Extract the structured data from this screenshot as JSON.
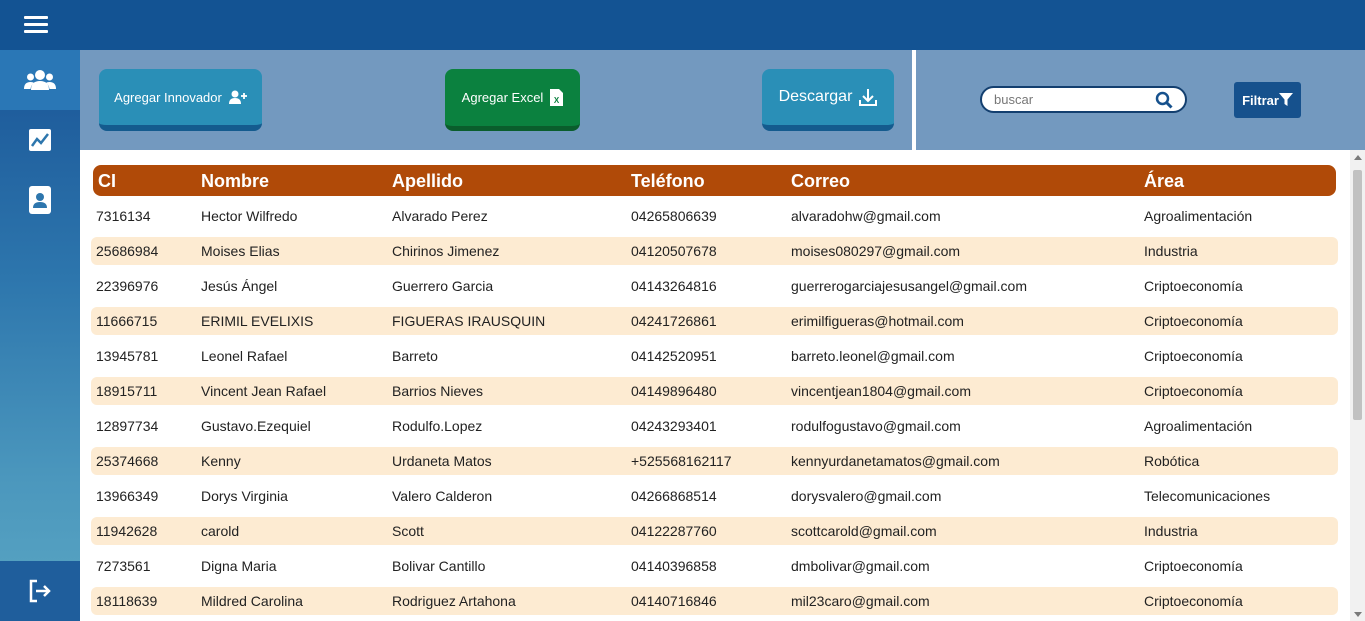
{
  "toolbar": {
    "agregar_label": "Agregar Innovador",
    "excel_label": "Agregar Excel",
    "descargar_label": "Descargar",
    "search_placeholder": "buscar",
    "filtrar_label": "Filtrar"
  },
  "sidebar": {
    "items": [
      {
        "icon": "users-icon",
        "active": true
      },
      {
        "icon": "chart-icon",
        "active": false
      },
      {
        "icon": "contact-icon",
        "active": false
      }
    ],
    "logout_icon": "logout-icon"
  },
  "table": {
    "headers": [
      "CI",
      "Nombre",
      "Apellido",
      "Teléfono",
      "Correo",
      "Área"
    ],
    "rows": [
      [
        "7316134",
        "Hector Wilfredo",
        "Alvarado Perez",
        "04265806639",
        "alvaradohw@gmail.com",
        "Agroalimentación"
      ],
      [
        "25686984",
        "Moises Elias",
        "Chirinos Jimenez",
        "04120507678",
        "moises080297@gmail.com",
        "Industria"
      ],
      [
        "22396976",
        "Jesús Ángel",
        "Guerrero Garcia",
        "04143264816",
        "guerrerogarciajesusangel@gmail.com",
        "Criptoeconomía"
      ],
      [
        "11666715",
        "ERIMIL EVELIXIS",
        "FIGUERAS IRAUSQUIN",
        "04241726861",
        "erimilfigueras@hotmail.com",
        "Criptoeconomía"
      ],
      [
        "13945781",
        "Leonel Rafael",
        "Barreto",
        "04142520951",
        "barreto.leonel@gmail.com",
        "Criptoeconomía"
      ],
      [
        "18915711",
        "Vincent Jean Rafael",
        "Barrios Nieves",
        "04149896480",
        "vincentjean1804@gmail.com",
        "Criptoeconomía"
      ],
      [
        "12897734",
        "Gustavo.Ezequiel",
        "Rodulfo.Lopez",
        "04243293401",
        "rodulfogustavo@gmail.com",
        "Agroalimentación"
      ],
      [
        "25374668",
        "Kenny",
        "Urdaneta Matos",
        "+525568162117",
        "kennyurdanetamatos@gmail.com",
        "Robótica"
      ],
      [
        "13966349",
        "Dorys Virginia",
        "Valero Calderon",
        "04266868514",
        "dorysvalero@gmail.com",
        "Telecomunicaciones"
      ],
      [
        "11942628",
        "carold",
        "Scott",
        "04122287760",
        "scottcarold@gmail.com",
        "Industria"
      ],
      [
        "7273561",
        "Digna Maria",
        "Bolivar Cantillo",
        "04140396858",
        "dmbolivar@gmail.com",
        "Criptoeconomía"
      ],
      [
        "18118639",
        "Mildred Carolina",
        "Rodriguez Artahona",
        "04140716846",
        "mil23caro@gmail.com",
        "Criptoeconomía"
      ]
    ]
  },
  "colors": {
    "topbar": "#135393",
    "header_row": "#b04a08",
    "alt_row": "#fdebd2",
    "excel_button": "#0b813f",
    "primary_button": "#2a8fb7"
  }
}
